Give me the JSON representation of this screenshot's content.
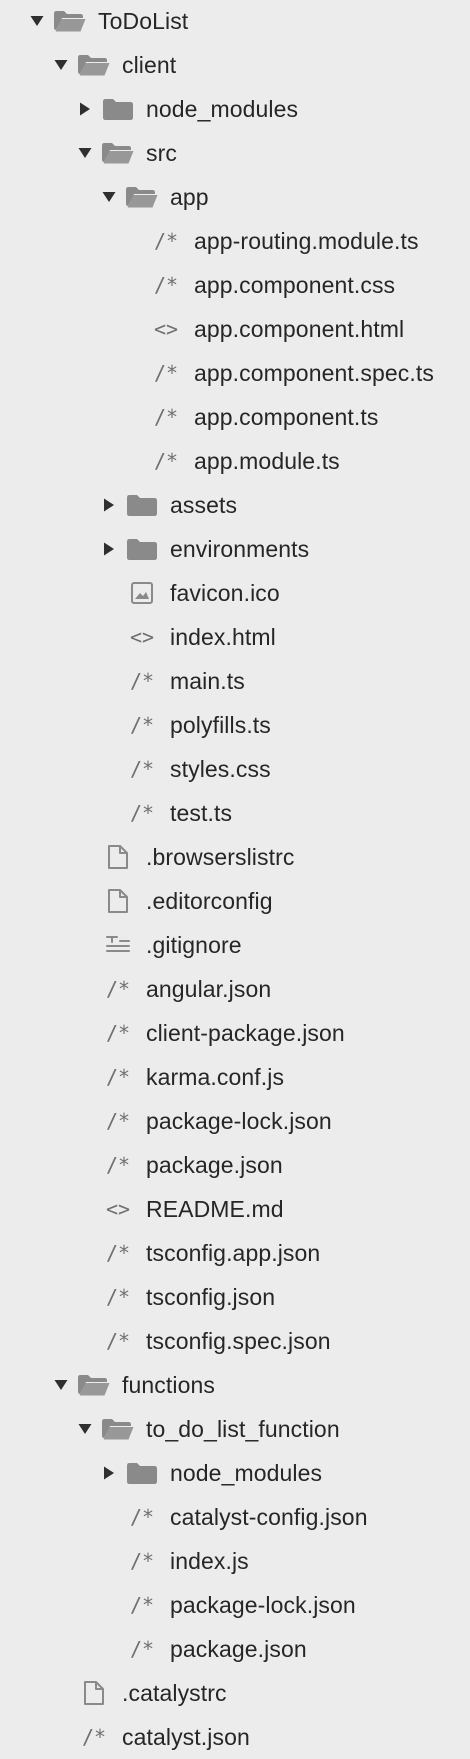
{
  "tree": [
    {
      "label": "ToDoList",
      "icon": "folder-open-icon",
      "level": 0,
      "disclosure": "expanded"
    },
    {
      "label": "client",
      "icon": "folder-open-icon",
      "level": 1,
      "disclosure": "expanded"
    },
    {
      "label": "node_modules",
      "icon": "folder-icon",
      "level": 2,
      "disclosure": "collapsed"
    },
    {
      "label": "src",
      "icon": "folder-open-icon",
      "level": 2,
      "disclosure": "expanded"
    },
    {
      "label": "app",
      "icon": "folder-open-icon",
      "level": 3,
      "disclosure": "expanded"
    },
    {
      "label": "app-routing.module.ts",
      "icon": "script-file-icon",
      "level": 4,
      "disclosure": "none"
    },
    {
      "label": "app.component.css",
      "icon": "script-file-icon",
      "level": 4,
      "disclosure": "none"
    },
    {
      "label": "app.component.html",
      "icon": "markup-file-icon",
      "level": 4,
      "disclosure": "none"
    },
    {
      "label": "app.component.spec.ts",
      "icon": "script-file-icon",
      "level": 4,
      "disclosure": "none"
    },
    {
      "label": "app.component.ts",
      "icon": "script-file-icon",
      "level": 4,
      "disclosure": "none"
    },
    {
      "label": "app.module.ts",
      "icon": "script-file-icon",
      "level": 4,
      "disclosure": "none"
    },
    {
      "label": "assets",
      "icon": "folder-icon",
      "level": 3,
      "disclosure": "collapsed"
    },
    {
      "label": "environments",
      "icon": "folder-icon",
      "level": 3,
      "disclosure": "collapsed"
    },
    {
      "label": "favicon.ico",
      "icon": "image-file-icon",
      "level": 3,
      "disclosure": "none"
    },
    {
      "label": "index.html",
      "icon": "markup-file-icon",
      "level": 3,
      "disclosure": "none"
    },
    {
      "label": "main.ts",
      "icon": "script-file-icon",
      "level": 3,
      "disclosure": "none"
    },
    {
      "label": "polyfills.ts",
      "icon": "script-file-icon",
      "level": 3,
      "disclosure": "none"
    },
    {
      "label": "styles.css",
      "icon": "script-file-icon",
      "level": 3,
      "disclosure": "none"
    },
    {
      "label": "test.ts",
      "icon": "script-file-icon",
      "level": 3,
      "disclosure": "none"
    },
    {
      "label": ".browserslistrc",
      "icon": "document-icon",
      "level": 2,
      "disclosure": "none"
    },
    {
      "label": ".editorconfig",
      "icon": "document-icon",
      "level": 2,
      "disclosure": "none"
    },
    {
      "label": ".gitignore",
      "icon": "text-lines-icon",
      "level": 2,
      "disclosure": "none"
    },
    {
      "label": "angular.json",
      "icon": "script-file-icon",
      "level": 2,
      "disclosure": "none"
    },
    {
      "label": "client-package.json",
      "icon": "script-file-icon",
      "level": 2,
      "disclosure": "none"
    },
    {
      "label": "karma.conf.js",
      "icon": "script-file-icon",
      "level": 2,
      "disclosure": "none"
    },
    {
      "label": "package-lock.json",
      "icon": "script-file-icon",
      "level": 2,
      "disclosure": "none"
    },
    {
      "label": "package.json",
      "icon": "script-file-icon",
      "level": 2,
      "disclosure": "none"
    },
    {
      "label": "README.md",
      "icon": "markup-file-icon",
      "level": 2,
      "disclosure": "none"
    },
    {
      "label": "tsconfig.app.json",
      "icon": "script-file-icon",
      "level": 2,
      "disclosure": "none"
    },
    {
      "label": "tsconfig.json",
      "icon": "script-file-icon",
      "level": 2,
      "disclosure": "none"
    },
    {
      "label": "tsconfig.spec.json",
      "icon": "script-file-icon",
      "level": 2,
      "disclosure": "none"
    },
    {
      "label": "functions",
      "icon": "folder-open-icon",
      "level": 1,
      "disclosure": "expanded"
    },
    {
      "label": "to_do_list_function",
      "icon": "folder-open-icon",
      "level": 2,
      "disclosure": "expanded"
    },
    {
      "label": "node_modules",
      "icon": "folder-icon",
      "level": 3,
      "disclosure": "collapsed"
    },
    {
      "label": "catalyst-config.json",
      "icon": "script-file-icon",
      "level": 3,
      "disclosure": "none"
    },
    {
      "label": "index.js",
      "icon": "script-file-icon",
      "level": 3,
      "disclosure": "none"
    },
    {
      "label": "package-lock.json",
      "icon": "script-file-icon",
      "level": 3,
      "disclosure": "none"
    },
    {
      "label": "package.json",
      "icon": "script-file-icon",
      "level": 3,
      "disclosure": "none"
    },
    {
      "label": ".catalystrc",
      "icon": "document-icon",
      "level": 1,
      "disclosure": "none"
    },
    {
      "label": "catalyst.json",
      "icon": "script-file-icon",
      "level": 1,
      "disclosure": "none"
    }
  ],
  "colors": {
    "background": "#ececec",
    "icon": "#8a8a8a",
    "disclosure": "#2f2f2f",
    "text": "#262626"
  }
}
